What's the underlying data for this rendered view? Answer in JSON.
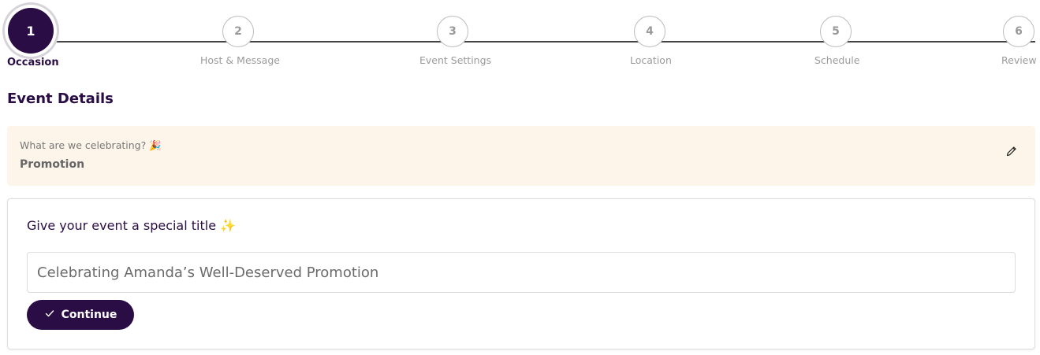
{
  "stepper": {
    "steps": [
      {
        "number": "1",
        "label": "Occasion",
        "state": "active"
      },
      {
        "number": "2",
        "label": "Host & Message",
        "state": "pending"
      },
      {
        "number": "3",
        "label": "Event Settings",
        "state": "pending"
      },
      {
        "number": "4",
        "label": "Location",
        "state": "pending"
      },
      {
        "number": "5",
        "label": "Schedule",
        "state": "pending"
      },
      {
        "number": "6",
        "label": "Review",
        "state": "pending"
      }
    ]
  },
  "section": {
    "title": "Event Details"
  },
  "occasion": {
    "question": "What are we celebrating? 🎉",
    "value": "Promotion",
    "edit_icon": "pencil-icon"
  },
  "event_title": {
    "prompt": "Give your event a special title ✨",
    "input_value": "Celebrating Amanda’s Well-Deserved Promotion"
  },
  "continue": {
    "label": "Continue",
    "icon": "check-icon"
  },
  "colors": {
    "primary": "#2a0d45",
    "occasion_bg": "#fdf5ea",
    "muted": "#9a9a9a"
  }
}
